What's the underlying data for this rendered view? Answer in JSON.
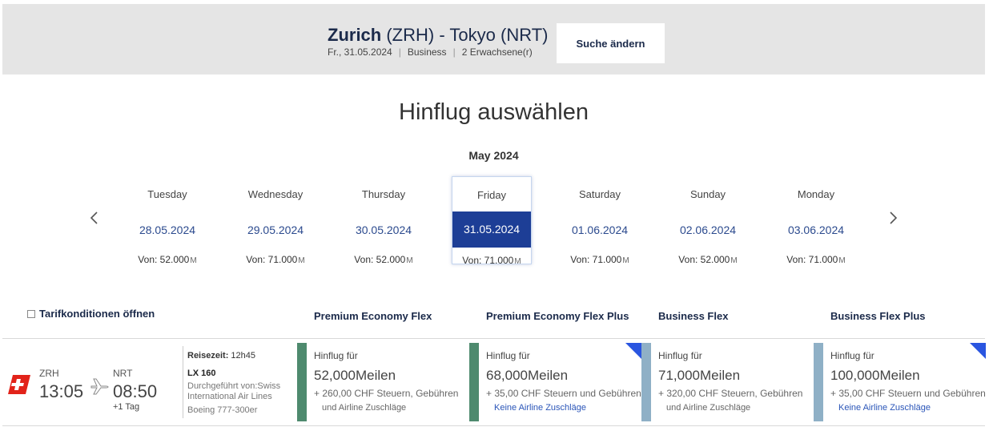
{
  "header": {
    "route_from": "Zurich",
    "route_from_code": "(ZRH)",
    "route_sep": "-",
    "route_to": "Tokyo",
    "route_to_code": "(NRT)",
    "date": "Fr., 31.05.2024",
    "cabin": "Business",
    "passengers": "2 Erwachsene(r)",
    "separator": "|",
    "change_button": "Suche ändern"
  },
  "page_title": "Hinflug auswählen",
  "month": "May 2024",
  "nav": {
    "prev_icon": "chevron-left-icon",
    "next_icon": "chevron-right-icon"
  },
  "days": [
    {
      "name": "Tuesday",
      "date": "28.05.2024",
      "price": "Von: 52.000",
      "selected": false
    },
    {
      "name": "Wednesday",
      "date": "29.05.2024",
      "price": "Von: 71.000",
      "selected": false
    },
    {
      "name": "Thursday",
      "date": "30.05.2024",
      "price": "Von: 52.000",
      "selected": false
    },
    {
      "name": "Friday",
      "date": "31.05.2024",
      "price": "Von: 71.000",
      "selected": true
    },
    {
      "name": "Saturday",
      "date": "01.06.2024",
      "price": "Von: 71.000",
      "selected": false
    },
    {
      "name": "Sunday",
      "date": "02.06.2024",
      "price": "Von: 52.000",
      "selected": false
    },
    {
      "name": "Monday",
      "date": "03.06.2024",
      "price": "Von: 71.000",
      "selected": false
    }
  ],
  "miles_icon_glyph": "M",
  "tarif_link": "Tarifkonditionen öffnen",
  "fare_columns": [
    "Premium Economy Flex",
    "Premium Economy Flex Plus",
    "Business Flex",
    "Business Flex Plus"
  ],
  "flight": {
    "dep_code": "ZRH",
    "dep_time": "13:05",
    "arr_code": "NRT",
    "arr_time": "08:50",
    "plus_day": "+1 Tag",
    "duration_label": "Reisezeit:",
    "duration": "12h45",
    "flight_no": "LX 160",
    "operated_by": "Durchgeführt von:Swiss International Air Lines",
    "aircraft": "Boeing 777-300er",
    "airline_logo": "swiss-cross-logo"
  },
  "fares": [
    {
      "label": "Hinflug für",
      "miles": "52,000Meilen",
      "fee_line1": "+ 260,00 CHF Steuern, Gebühren",
      "fee_line2": "und Airline Zuschläge",
      "bar_color": "#4e8a6e",
      "flag": false
    },
    {
      "label": "Hinflug für",
      "miles": "68,000Meilen",
      "fee_line1": "+ 35,00 CHF Steuern und Gebühren",
      "fee_line2": "Keine Airline Zuschläge",
      "bar_color": "#4e8a6e",
      "flag": true
    },
    {
      "label": "Hinflug für",
      "miles": "71,000Meilen",
      "fee_line1": "+ 320,00 CHF Steuern, Gebühren",
      "fee_line2": "und Airline Zuschläge",
      "bar_color": "#8fb0c6",
      "flag": false
    },
    {
      "label": "Hinflug für",
      "miles": "100,000Meilen",
      "fee_line1": "+ 35,00 CHF Steuern und Gebühren",
      "fee_line2": "Keine Airline Zuschläge",
      "bar_color": "#8fb0c6",
      "flag": true
    }
  ],
  "colors": {
    "accent": "#1d3e96",
    "link": "#2a55b8",
    "header_bg": "#e5e5e5",
    "swiss_red": "#e2231a"
  }
}
